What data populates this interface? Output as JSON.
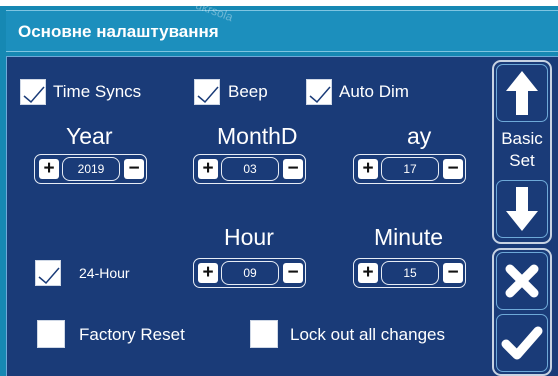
{
  "header": {
    "title": "Основне налаштування"
  },
  "options": {
    "time_syncs": {
      "label": "Time Syncs",
      "checked": true
    },
    "beep": {
      "label": "Beep",
      "checked": true
    },
    "auto_dim": {
      "label": "Auto Dim",
      "checked": true
    }
  },
  "date": {
    "year_label": "Year",
    "month_label": "MonthD",
    "day_label": "ay",
    "year": "2019",
    "month": "03",
    "day": "17"
  },
  "time": {
    "hour_format": {
      "label": "24-Hour",
      "checked": true
    },
    "hour_label": "Hour",
    "minute_label": "Minute",
    "hour": "09",
    "minute": "15"
  },
  "bottom": {
    "factory_reset": {
      "label": "Factory Reset",
      "checked": false
    },
    "lock_out": {
      "label": "Lock out all changes",
      "checked": false
    }
  },
  "spinner": {
    "plus": "+",
    "minus": "−"
  },
  "sidebar": {
    "basic_set_label_1": "Basic",
    "basic_set_label_2": "Set"
  },
  "watermark": "ukrsola"
}
